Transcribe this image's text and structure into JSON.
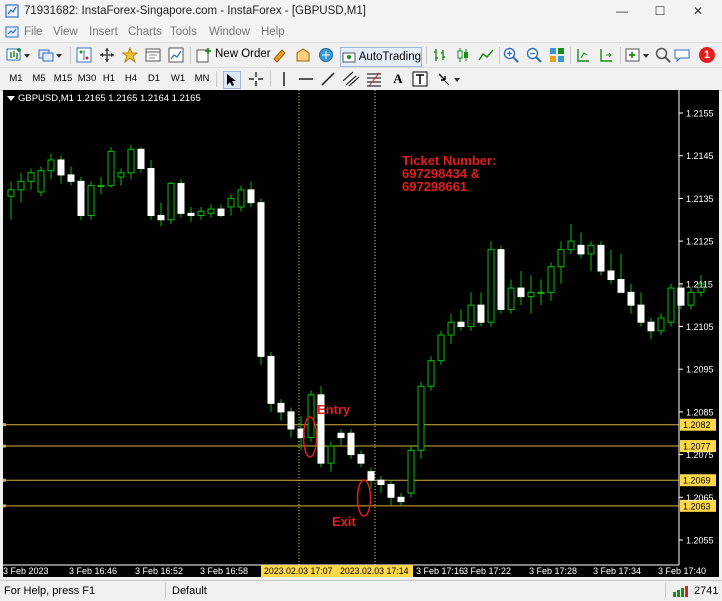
{
  "window": {
    "title": "71931682: InstaForex-Singapore.com - InstaForex - [GBPUSD,M1]",
    "controls": {
      "minimize": "—",
      "maximize": "☐",
      "close": "✕"
    }
  },
  "menu": {
    "items": [
      "File",
      "View",
      "Insert",
      "Charts",
      "Tools",
      "Window",
      "Help"
    ]
  },
  "toolbar": {
    "new_order_label": "New Order",
    "autotrading_label": "AutoTrading",
    "notification_badge": "1"
  },
  "timeframes": [
    "M1",
    "M5",
    "M15",
    "M30",
    "H1",
    "H4",
    "D1",
    "W1",
    "MN"
  ],
  "chart": {
    "header": "GBPUSD,M1  1.2165 1.2165 1.2164 1.2165",
    "price_labels": [
      "1.2155",
      "1.2145",
      "1.2135",
      "1.2125",
      "1.2115",
      "1.2105",
      "1.2095",
      "1.2085",
      "1.2075",
      "1.2065",
      "1.2055"
    ],
    "time_labels": [
      "3 Feb 2023",
      "3 Feb 16:46",
      "3 Feb 16:52",
      "3 Feb 16:58",
      "3 Feb 17:16",
      "3 Feb 17:22",
      "3 Feb 17:28",
      "3 Feb 17:34",
      "3 Feb 17:40"
    ],
    "highlighted_times": [
      "2023.02.03 17:07",
      "2023.02.03 17:14"
    ],
    "hlines": [
      "1.2082",
      "1.2077",
      "1.2069",
      "1.2063"
    ],
    "annotations": {
      "ticket_line1": "Ticket Number:",
      "ticket_line2": "697298434 &",
      "ticket_line3": "697298661",
      "entry": "Entry",
      "exit": "Exit"
    },
    "colors": {
      "background": "#000000",
      "bull": "#ffffff",
      "bear": "#ffffff",
      "wick": "#00c000",
      "level_line": "#d8b040",
      "annotation": "#e21d1d"
    }
  },
  "chart_data": {
    "type": "candlestick",
    "symbol": "GBPUSD",
    "timeframe": "M1",
    "ylim": [
      1.205,
      1.216
    ],
    "candles": [
      {
        "o": 1.21355,
        "h": 1.2139,
        "l": 1.213,
        "c": 1.2137
      },
      {
        "o": 1.2137,
        "h": 1.2141,
        "l": 1.2134,
        "c": 1.2139
      },
      {
        "o": 1.2139,
        "h": 1.2142,
        "l": 1.2137,
        "c": 1.2141
      },
      {
        "o": 1.21365,
        "h": 1.21425,
        "l": 1.21355,
        "c": 1.21415
      },
      {
        "o": 1.21415,
        "h": 1.21455,
        "l": 1.21395,
        "c": 1.2144
      },
      {
        "o": 1.2144,
        "h": 1.2145,
        "l": 1.21385,
        "c": 1.21405
      },
      {
        "o": 1.21405,
        "h": 1.21425,
        "l": 1.2138,
        "c": 1.2139
      },
      {
        "o": 1.2139,
        "h": 1.214,
        "l": 1.213,
        "c": 1.2131
      },
      {
        "o": 1.2131,
        "h": 1.2139,
        "l": 1.213,
        "c": 1.2138
      },
      {
        "o": 1.2138,
        "h": 1.214,
        "l": 1.2136,
        "c": 1.2138
      },
      {
        "o": 1.2138,
        "h": 1.2147,
        "l": 1.21375,
        "c": 1.2146
      },
      {
        "o": 1.214,
        "h": 1.2142,
        "l": 1.2138,
        "c": 1.2141
      },
      {
        "o": 1.2141,
        "h": 1.21475,
        "l": 1.21395,
        "c": 1.21465
      },
      {
        "o": 1.21465,
        "h": 1.2147,
        "l": 1.2141,
        "c": 1.2142
      },
      {
        "o": 1.2142,
        "h": 1.2144,
        "l": 1.213,
        "c": 1.2131
      },
      {
        "o": 1.2131,
        "h": 1.2134,
        "l": 1.21285,
        "c": 1.213
      },
      {
        "o": 1.213,
        "h": 1.2139,
        "l": 1.2129,
        "c": 1.21385
      },
      {
        "o": 1.21385,
        "h": 1.21395,
        "l": 1.21305,
        "c": 1.21315
      },
      {
        "o": 1.21315,
        "h": 1.2133,
        "l": 1.21295,
        "c": 1.2131
      },
      {
        "o": 1.2131,
        "h": 1.2133,
        "l": 1.213,
        "c": 1.2132
      },
      {
        "o": 1.21315,
        "h": 1.21335,
        "l": 1.21305,
        "c": 1.21325
      },
      {
        "o": 1.21325,
        "h": 1.21335,
        "l": 1.21305,
        "c": 1.2131
      },
      {
        "o": 1.2133,
        "h": 1.2136,
        "l": 1.2131,
        "c": 1.2135
      },
      {
        "o": 1.2133,
        "h": 1.2138,
        "l": 1.2132,
        "c": 1.2137
      },
      {
        "o": 1.2137,
        "h": 1.2139,
        "l": 1.2133,
        "c": 1.2134
      },
      {
        "o": 1.2134,
        "h": 1.2135,
        "l": 1.2096,
        "c": 1.2098
      },
      {
        "o": 1.2098,
        "h": 1.2099,
        "l": 1.2085,
        "c": 1.2087
      },
      {
        "o": 1.2087,
        "h": 1.2088,
        "l": 1.2083,
        "c": 1.2085
      },
      {
        "o": 1.2085,
        "h": 1.2086,
        "l": 1.2079,
        "c": 1.2081
      },
      {
        "o": 1.2081,
        "h": 1.2084,
        "l": 1.2076,
        "c": 1.2079
      },
      {
        "o": 1.2079,
        "h": 1.209,
        "l": 1.2078,
        "c": 1.2089
      },
      {
        "o": 1.2089,
        "h": 1.2091,
        "l": 1.2072,
        "c": 1.2073
      },
      {
        "o": 1.2073,
        "h": 1.2078,
        "l": 1.2071,
        "c": 1.2077
      },
      {
        "o": 1.208,
        "h": 1.2081,
        "l": 1.2077,
        "c": 1.2079
      },
      {
        "o": 1.208,
        "h": 1.2081,
        "l": 1.2074,
        "c": 1.2075
      },
      {
        "o": 1.2075,
        "h": 1.2076,
        "l": 1.2072,
        "c": 1.2073
      },
      {
        "o": 1.2071,
        "h": 1.2072,
        "l": 1.2067,
        "c": 1.2069
      },
      {
        "o": 1.2069,
        "h": 1.207,
        "l": 1.2066,
        "c": 1.2068
      },
      {
        "o": 1.2068,
        "h": 1.2069,
        "l": 1.2063,
        "c": 1.2065
      },
      {
        "o": 1.2065,
        "h": 1.2066,
        "l": 1.2063,
        "c": 1.2064
      },
      {
        "o": 1.2066,
        "h": 1.2077,
        "l": 1.2065,
        "c": 1.2076
      },
      {
        "o": 1.2076,
        "h": 1.2092,
        "l": 1.2074,
        "c": 1.2091
      },
      {
        "o": 1.2091,
        "h": 1.2098,
        "l": 1.209,
        "c": 1.2097
      },
      {
        "o": 1.2097,
        "h": 1.2104,
        "l": 1.2096,
        "c": 1.2103
      },
      {
        "o": 1.2103,
        "h": 1.2108,
        "l": 1.2101,
        "c": 1.2106
      },
      {
        "o": 1.2106,
        "h": 1.2109,
        "l": 1.2104,
        "c": 1.2105
      },
      {
        "o": 1.2105,
        "h": 1.2113,
        "l": 1.2104,
        "c": 1.211
      },
      {
        "o": 1.211,
        "h": 1.2113,
        "l": 1.2105,
        "c": 1.2106
      },
      {
        "o": 1.2106,
        "h": 1.2125,
        "l": 1.2105,
        "c": 1.2123
      },
      {
        "o": 1.2123,
        "h": 1.2124,
        "l": 1.2108,
        "c": 1.2109
      },
      {
        "o": 1.2109,
        "h": 1.2116,
        "l": 1.2108,
        "c": 1.2114
      },
      {
        "o": 1.2114,
        "h": 1.2118,
        "l": 1.211,
        "c": 1.2112
      },
      {
        "o": 1.2112,
        "h": 1.2117,
        "l": 1.2108,
        "c": 1.2113
      },
      {
        "o": 1.2113,
        "h": 1.2116,
        "l": 1.211,
        "c": 1.2113
      },
      {
        "o": 1.2113,
        "h": 1.212,
        "l": 1.2111,
        "c": 1.2119
      },
      {
        "o": 1.2119,
        "h": 1.2125,
        "l": 1.2115,
        "c": 1.2123
      },
      {
        "o": 1.2123,
        "h": 1.2129,
        "l": 1.2122,
        "c": 1.2125
      },
      {
        "o": 1.2124,
        "h": 1.2127,
        "l": 1.2121,
        "c": 1.2122
      },
      {
        "o": 1.2122,
        "h": 1.2125,
        "l": 1.2118,
        "c": 1.2124
      },
      {
        "o": 1.2124,
        "h": 1.2125,
        "l": 1.2117,
        "c": 1.2118
      },
      {
        "o": 1.2118,
        "h": 1.2123,
        "l": 1.2115,
        "c": 1.2116
      },
      {
        "o": 1.2116,
        "h": 1.2122,
        "l": 1.2113,
        "c": 1.2113
      },
      {
        "o": 1.2113,
        "h": 1.2115,
        "l": 1.2108,
        "c": 1.211
      },
      {
        "o": 1.211,
        "h": 1.2113,
        "l": 1.2105,
        "c": 1.2106
      },
      {
        "o": 1.2106,
        "h": 1.2107,
        "l": 1.2102,
        "c": 1.2104
      },
      {
        "o": 1.2104,
        "h": 1.2108,
        "l": 1.2103,
        "c": 1.2107
      },
      {
        "o": 1.2106,
        "h": 1.2115,
        "l": 1.2105,
        "c": 1.2114
      },
      {
        "o": 1.2114,
        "h": 1.2115,
        "l": 1.2109,
        "c": 1.211
      },
      {
        "o": 1.211,
        "h": 1.2114,
        "l": 1.2109,
        "c": 1.2113
      },
      {
        "o": 1.2113,
        "h": 1.2117,
        "l": 1.2112,
        "c": 1.2115
      }
    ]
  }
}
